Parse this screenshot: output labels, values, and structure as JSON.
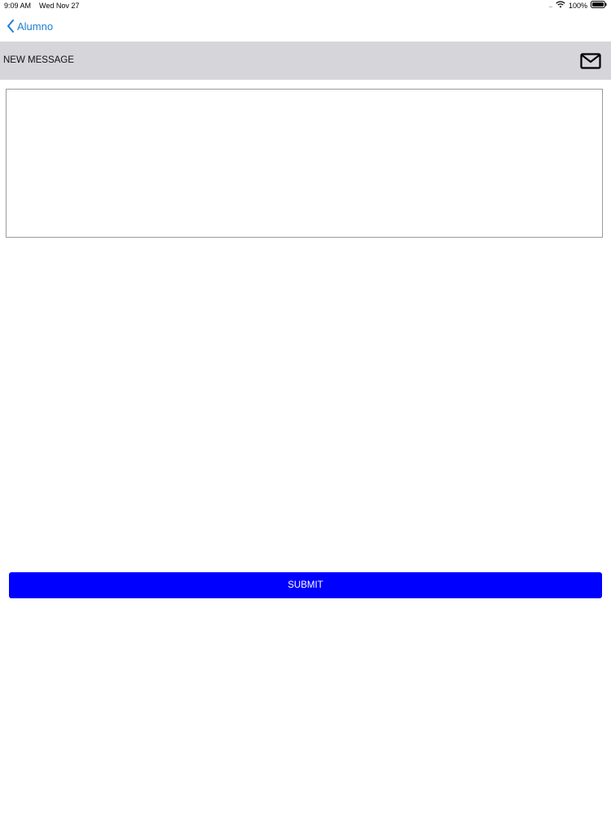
{
  "status_bar": {
    "time": "9:09 AM",
    "date": "Wed Nov 27",
    "signal": "....",
    "battery_percent": "100%",
    "icons": [
      "wifi-icon",
      "battery-icon"
    ]
  },
  "nav": {
    "back_label": "Alumno",
    "back_icon": "chevron-left-icon"
  },
  "header": {
    "title": "NEW MESSAGE",
    "icon": "mail-icon"
  },
  "message": {
    "value": "",
    "placeholder": ""
  },
  "submit": {
    "label": "SUBMIT"
  },
  "colors": {
    "accent": "#1e7fd0",
    "header_bg": "#d6d5da",
    "submit_bg": "#0000ff",
    "submit_text": "#ffffff"
  }
}
